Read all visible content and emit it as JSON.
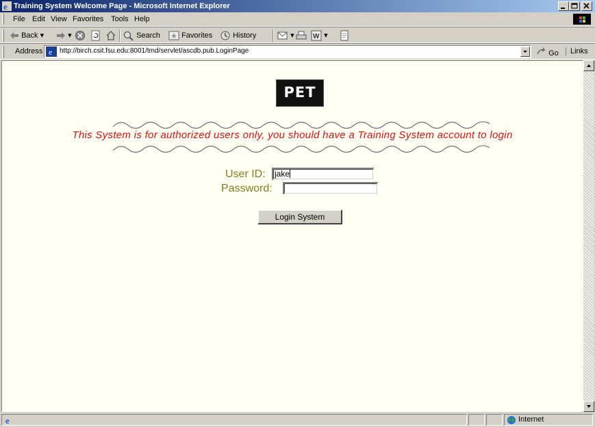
{
  "window": {
    "title": "Training System Welcome Page - Microsoft Internet Explorer"
  },
  "menu": [
    "File",
    "Edit",
    "View",
    "Favorites",
    "Tools",
    "Help"
  ],
  "toolbar": {
    "back": "Back",
    "search": "Search",
    "favorites": "Favorites",
    "history": "History"
  },
  "address": {
    "label": "Address",
    "url": "http://birch.csit.fsu.edu:8001/tmd/servlet/ascdb.pub.LoginPage",
    "go": "Go",
    "links": "Links"
  },
  "page": {
    "logo_text": "PET",
    "notice": "This System is for authorized users only, you should have a Training System account to login",
    "userid_label": "User ID:",
    "userid_value": "jake",
    "password_label": "Password:",
    "password_value": "",
    "login_button": "Login System"
  },
  "status": {
    "zone": "Internet"
  },
  "colors": {
    "notice": "#e01010",
    "label": "#808020",
    "background": "#fffff3",
    "titlebar": "#0a246a"
  }
}
